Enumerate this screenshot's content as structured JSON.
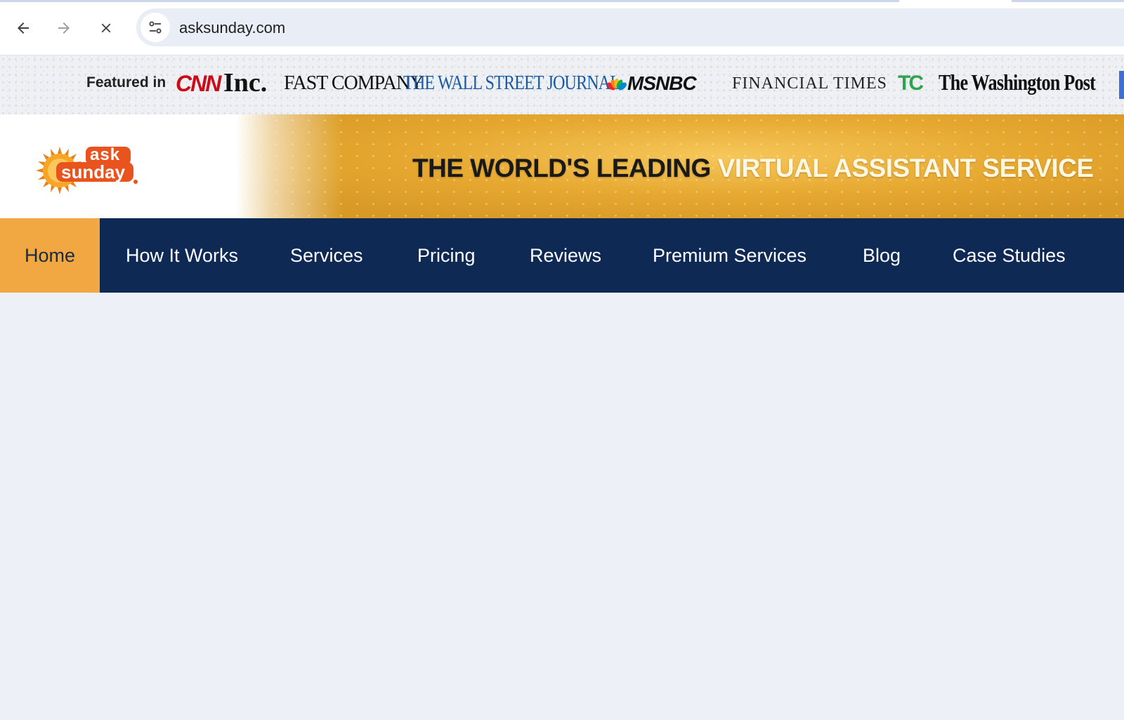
{
  "browser": {
    "url": "asksunday.com"
  },
  "featured": {
    "label": "Featured in",
    "logos": {
      "cnn": "CNN",
      "inc": "Inc.",
      "fast_company": "FAST COMPANY",
      "wsj": "THE WALL STREET JOURNAL.",
      "msnbc": "MSNBC",
      "ft": "FINANCIAL TIMES",
      "tc": "TC",
      "wapo": "The Washington Post"
    }
  },
  "header": {
    "logo_text_top": "ask",
    "logo_text_bottom": "sunday",
    "tagline_dark": "THE WORLD'S LEADING",
    "tagline_light": "VIRTUAL ASSISTANT SERVICE"
  },
  "nav": {
    "items": [
      {
        "label": "Home",
        "active": true
      },
      {
        "label": "How It Works"
      },
      {
        "label": "Services"
      },
      {
        "label": "Pricing"
      },
      {
        "label": "Reviews"
      },
      {
        "label": "Premium Services"
      },
      {
        "label": "Blog"
      },
      {
        "label": "Case Studies"
      }
    ]
  },
  "colors": {
    "nav_bg": "#0f2955",
    "nav_active": "#f2a842",
    "banner_gold": "#e6a830"
  }
}
